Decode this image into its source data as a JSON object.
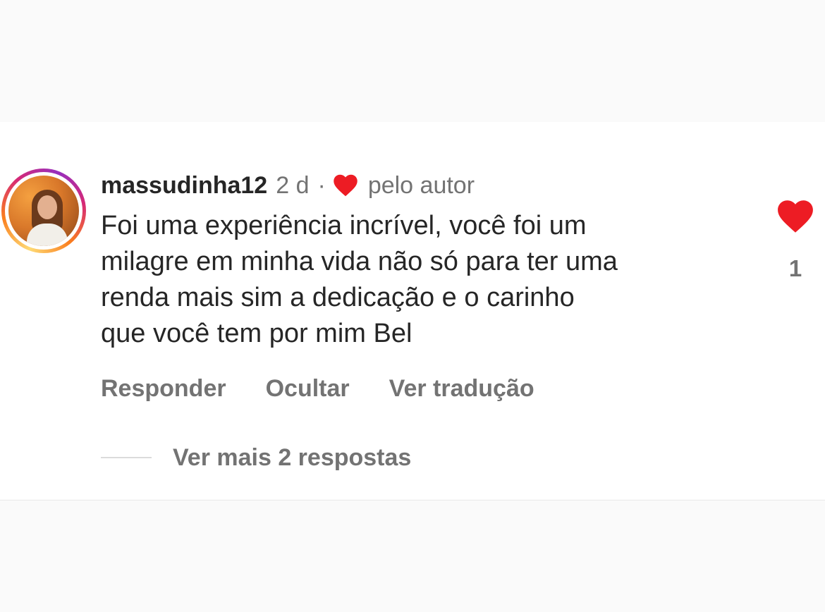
{
  "comment": {
    "username": "massudinha12",
    "time": "2 d",
    "separator": "·",
    "liked_by_author_label": "pelo autor",
    "text_lines": [
      "Foi uma experiência incrível, você foi um",
      "milagre em minha vida não só para ter uma",
      "renda mais sim a dedicação e o carinho",
      "que você tem por mim Bel"
    ],
    "like_count": "1",
    "actions": {
      "reply": "Responder",
      "hide": "Ocultar",
      "translate": "Ver tradução"
    },
    "view_replies": "Ver mais 2 respostas"
  },
  "icons": {
    "author_heart": "heart-icon",
    "like": "heart-filled-icon",
    "avatar": "profile-photo"
  },
  "colors": {
    "heart": "#ed1c24",
    "text_primary": "#262626",
    "text_secondary": "#737373",
    "story_ring": [
      "#feda75",
      "#fa7e1e",
      "#d62976",
      "#962fbf"
    ]
  }
}
